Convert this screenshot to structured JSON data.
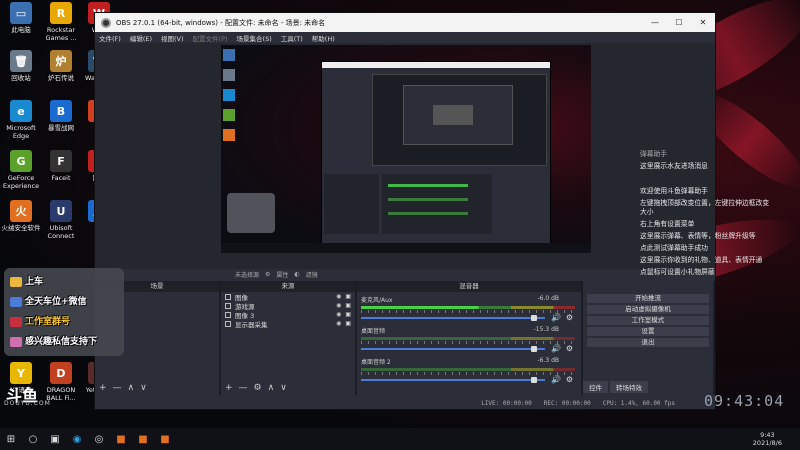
{
  "desktop": {
    "icons": [
      {
        "label": "此电脑",
        "color": "#3a6fb0",
        "glyph": "▭"
      },
      {
        "label": "回收站",
        "color": "#6a7a8a",
        "glyph": "🗑"
      },
      {
        "label": "Microsoft Edge",
        "color": "#1a8ad0",
        "glyph": "e"
      },
      {
        "label": "GeForce Experience",
        "color": "#5aa02a",
        "glyph": "G"
      },
      {
        "label": "火绒安全软件",
        "color": "#e07020",
        "glyph": "火"
      },
      {
        "label": "Rockstar Games ...",
        "color": "#e8a800",
        "glyph": "R"
      },
      {
        "label": "炉石传说",
        "color": "#b08030",
        "glyph": "炉"
      },
      {
        "label": "暴雪战网",
        "color": "#1a6ad0",
        "glyph": "B"
      },
      {
        "label": "Faceit",
        "color": "#333",
        "glyph": "F"
      },
      {
        "label": "Ubisoft Connect",
        "color": "#2a3a6a",
        "glyph": "U"
      },
      {
        "label": "YY语音",
        "color": "#e8b800",
        "glyph": "Y"
      },
      {
        "label": "DRAGON BALL Fi...",
        "color": "#c04020",
        "glyph": "D"
      },
      {
        "label": "WPS",
        "color": "#c02020",
        "glyph": "W"
      },
      {
        "label": "Wal Engi",
        "color": "#2a4a6a",
        "glyph": "W"
      },
      {
        "label": "O",
        "color": "#d04020",
        "glyph": "O"
      },
      {
        "label": "网易",
        "color": "#c02020",
        "glyph": "网"
      },
      {
        "label": "腾",
        "color": "#1a6ad0",
        "glyph": "腾"
      },
      {
        "label": "Yet Zom",
        "color": "#5a2a2a",
        "glyph": "Y"
      }
    ]
  },
  "obs": {
    "title": "OBS 27.0.1 (64-bit, windows) - 配置文件: 未命名 - 场景: 未命名",
    "menu": [
      "文件(F)",
      "编辑(E)",
      "视图(V)",
      "配置文件(P)",
      "场景集合(S)",
      "工具(T)",
      "帮助(H)"
    ],
    "source_toolbar": [
      "未选择源",
      "属性",
      "滤镜"
    ],
    "docks": {
      "scenes": {
        "header": "场景",
        "items": [
          "场景"
        ]
      },
      "sources": {
        "header": "来源",
        "items": [
          "图像",
          "游戏源",
          "图像 3",
          "显示器采集"
        ]
      },
      "mixer": {
        "header": "混音器",
        "channels": [
          {
            "name": "麦克风/Aux",
            "db": "-6.0 dB",
            "live": true
          },
          {
            "name": "桌面音频",
            "db": "-15.3 dB",
            "live": false
          },
          {
            "name": "桌面音频 2",
            "db": "-6.3 dB",
            "live": false
          }
        ]
      },
      "controls": {
        "buttons": [
          "开始推流",
          "启动虚拟摄像机",
          "工作室模式",
          "设置",
          "退出"
        ]
      }
    },
    "bottom_tabs": [
      "控件",
      "转场特效"
    ],
    "status": {
      "live": "LIVE: 00:00:00",
      "rec": "REC: 00:00:00",
      "cpu": "CPU: 1.4%, 60.00 fps"
    }
  },
  "overlay": {
    "lines": [
      "上车",
      "全天车位+微信",
      "工作室群号",
      "感兴趣私信支持下"
    ]
  },
  "chat": {
    "header": "弹幕助手",
    "messages": [
      "这里展示水友进场消息",
      "欢迎使用斗鱼弹幕助手",
      "左键拖拽顶部改变位置，左键拉伸边框改变大小",
      "右上角有设置菜单",
      "这里展示弹幕、表情等，粉丝牌升级等",
      "点此测试弹幕助手成功",
      "这里展示你收到的礼物、道具、表情开通",
      "点鼠标可设置小礼物屏蔽"
    ]
  },
  "watermark": {
    "brand": "斗鱼",
    "sub": "DOUYU.COM"
  },
  "taskbar": {
    "icons": [
      "windows-icon",
      "search-icon",
      "task-view-icon",
      "edge-icon",
      "obs-icon",
      "app-icon",
      "app-icon-2",
      "app-icon-3"
    ],
    "time": "9:43",
    "date": "2021/8/6",
    "big_time": "09:43:04"
  }
}
